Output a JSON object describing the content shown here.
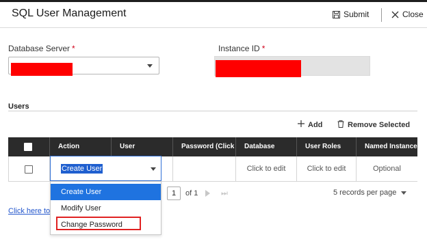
{
  "window": {
    "title": "SQL User Management"
  },
  "header": {
    "submit_label": "Submit",
    "close_label": "Close"
  },
  "form": {
    "database_server": {
      "label": "Database Server",
      "required_mark": "*"
    },
    "instance_id": {
      "label": "Instance ID",
      "required_mark": "*"
    }
  },
  "users": {
    "section_title": "Users",
    "add_label": "Add",
    "remove_label": "Remove Selected",
    "columns": [
      "Action",
      "User",
      "Password (Click to edit)",
      "Database",
      "User Roles",
      "Named Instance"
    ],
    "row": {
      "action": "Create User",
      "user": "",
      "password": "",
      "database": "Click to edit",
      "user_roles": "Click to edit",
      "named_instance": "Optional"
    },
    "action_options": [
      "Create User",
      "Modify User",
      "Change Password"
    ]
  },
  "pager": {
    "page": "1",
    "of_text": "of 1",
    "last_glyph": "⏭",
    "records_per_page": "5 records per page"
  },
  "footer_link": "Click here to",
  "colors": {
    "header_bg": "#2b2b2b",
    "selection": "#1f73e0",
    "highlight": "#e02020",
    "redaction": "#ff0000"
  }
}
